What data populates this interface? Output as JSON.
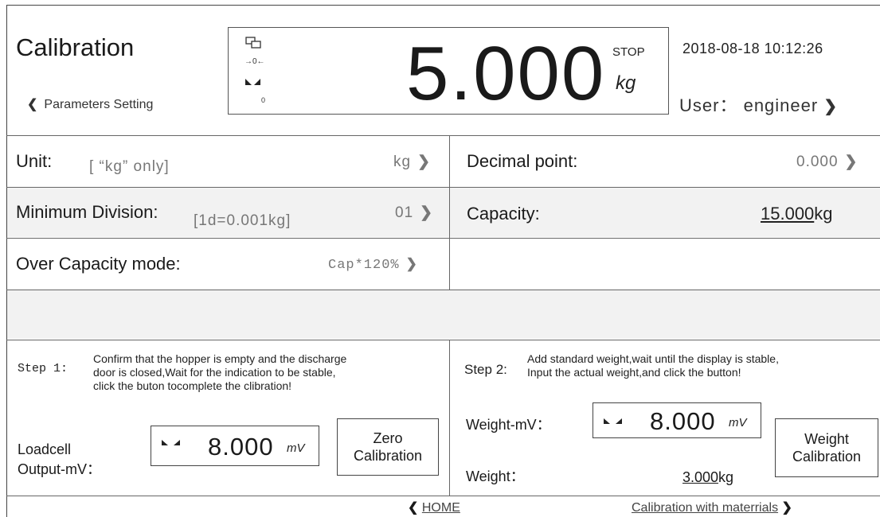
{
  "header": {
    "title": "Calibration",
    "back_label": "Parameters Setting",
    "datetime": "2018-08-18 10:12:26",
    "user_label": "User：",
    "user_name": "engineer"
  },
  "display": {
    "icon_zero_text": "→0←",
    "icon_zero_count": "0",
    "value": "5.000",
    "status": "STOP",
    "unit": "kg"
  },
  "settings": {
    "unit": {
      "label": "Unit:",
      "hint": "[ “kg” only]",
      "value": "kg"
    },
    "decimal_point": {
      "label": "Decimal point:",
      "value": "0.000"
    },
    "min_division": {
      "label": "Minimum Division:",
      "hint": "[1d=0.001kg]",
      "value": "01"
    },
    "capacity": {
      "label": "Capacity:",
      "value": "15.000",
      "unit": "kg"
    },
    "over_capacity": {
      "label": "Over Capacity mode:",
      "value": "Cap*120%"
    }
  },
  "step1": {
    "heading": "Step 1:",
    "text": [
      "Confirm that the hopper is empty and the discharge",
      "door is closed,Wait for the indication to be stable,",
      "click the buton tocomplete the clibration!"
    ],
    "output_label_1": "Loadcell",
    "output_label_2": "Output-mV：",
    "mv_value": "8.000",
    "mv_unit": "mV",
    "button_line1": "Zero",
    "button_line2": "Calibration"
  },
  "step2": {
    "heading": "Step 2:",
    "text": [
      "Add standard weight,wait until the display is stable,",
      "Input the actual weight,and click the button!"
    ],
    "weight_mv_label": "Weight-mV：",
    "mv_value": "8.000",
    "mv_unit": "mV",
    "weight_label": "Weight：",
    "weight_value": "3.000",
    "weight_unit": "kg",
    "button_line1": "Weight",
    "button_line2": "Calibration"
  },
  "footer": {
    "home": "HOME",
    "next": "Calibration with materrials"
  }
}
